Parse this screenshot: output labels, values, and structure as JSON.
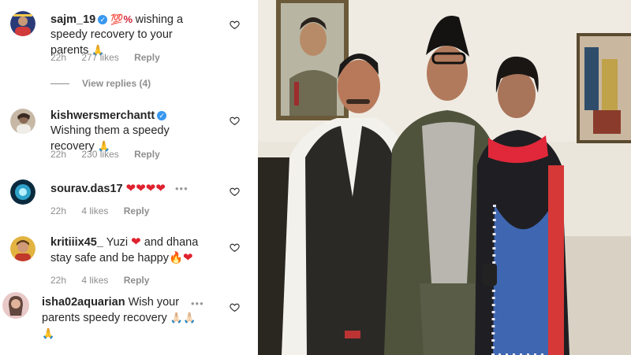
{
  "comments": [
    {
      "username": "sajm_19",
      "verified": true,
      "text_prefix": "💯% ",
      "text": "wishing a speedy recovery to your parents",
      "emoji": "🙏",
      "time": "22h",
      "likes": "277 likes",
      "reply": "Reply"
    },
    {
      "username": "kishwersmerchantt",
      "verified": true,
      "text": "Wishing them a speedy recovery",
      "emoji": "🙏",
      "time": "22h",
      "likes": "230 likes",
      "reply": "Reply"
    },
    {
      "username": "sourav.das17",
      "hearts": "❤❤❤❤",
      "dots": "•••",
      "time": "22h",
      "likes": "4 likes",
      "reply": "Reply"
    },
    {
      "username": "kritiiix45_",
      "text_a": "Yuzi",
      "heart": "❤",
      "text_b": "and dhana stay safe and be happy",
      "fire": "🔥",
      "heart2": "❤",
      "time": "22h",
      "likes": "4 likes",
      "reply": "Reply"
    },
    {
      "username": "isha02aquarian",
      "text": "Wish your parents speedy recovery",
      "emoji_a": "🙏🏻🙏🏻",
      "emoji_b": "🙏",
      "dots": "•••"
    }
  ],
  "view_replies": "View replies (4)",
  "icons": {
    "like": "heart-outline-icon",
    "verified": "verified-badge-icon",
    "more": "more-dots-icon"
  },
  "colors": {
    "text": "#262626",
    "meta": "#8e8e8e",
    "verified": "#3897f0",
    "heart": "#e0212e"
  }
}
